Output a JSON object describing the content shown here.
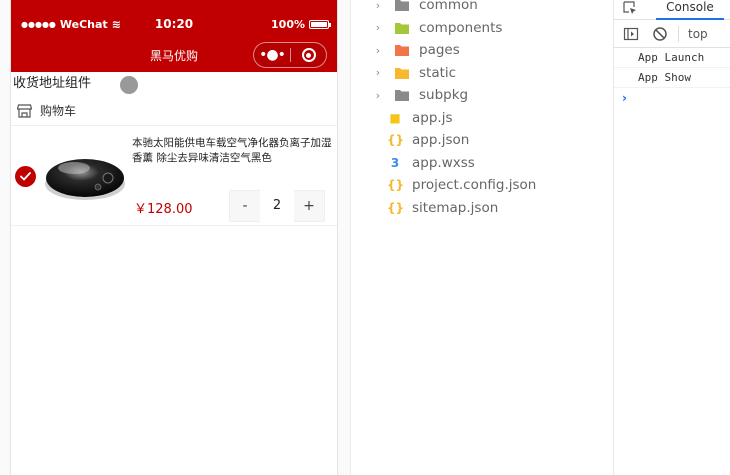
{
  "status_bar": {
    "signal": "●●●●●",
    "carrier": "WeChat",
    "wifi": "≋",
    "time": "10:20",
    "battery": "100%"
  },
  "navbar": {
    "title": "黑马优购",
    "more": "•●•",
    "bg": "#c00000"
  },
  "address_component": {
    "label": "收货地址组件"
  },
  "cart": {
    "title": "购物车",
    "items": [
      {
        "name": "本驰太阳能供电车载空气净化器负离子加湿香薰 除尘去异味清洁空气黑色",
        "price": "￥128.00",
        "quantity": "2",
        "checked": true,
        "minus": "-",
        "plus": "+"
      }
    ]
  },
  "explorer": {
    "items": [
      {
        "label": "common",
        "type": "folder",
        "color": "#8a8a8a"
      },
      {
        "label": "components",
        "type": "folder",
        "color": "#a5c83a"
      },
      {
        "label": "pages",
        "type": "folder",
        "color": "#f0764a"
      },
      {
        "label": "static",
        "type": "folder",
        "color": "#f5b82e"
      },
      {
        "label": "subpkg",
        "type": "folder",
        "color": "#8a8a8a"
      },
      {
        "label": "app.js",
        "type": "file",
        "icon": "js-icon",
        "color": "#f5c518",
        "glyph": "■"
      },
      {
        "label": "app.json",
        "type": "file",
        "icon": "json-icon",
        "color": "#f5b82e",
        "glyph": "{}"
      },
      {
        "label": "app.wxss",
        "type": "file",
        "icon": "css-icon",
        "color": "#3a8ee6",
        "glyph": "3"
      },
      {
        "label": "project.config.json",
        "type": "file",
        "icon": "json-icon",
        "color": "#f5b82e",
        "glyph": "{}"
      },
      {
        "label": "sitemap.json",
        "type": "file",
        "icon": "json-icon",
        "color": "#f5b82e",
        "glyph": "{}"
      }
    ]
  },
  "console": {
    "tab": "Console",
    "context": "top",
    "lines": [
      "App Launch",
      "App Show"
    ],
    "prompt": "›"
  }
}
